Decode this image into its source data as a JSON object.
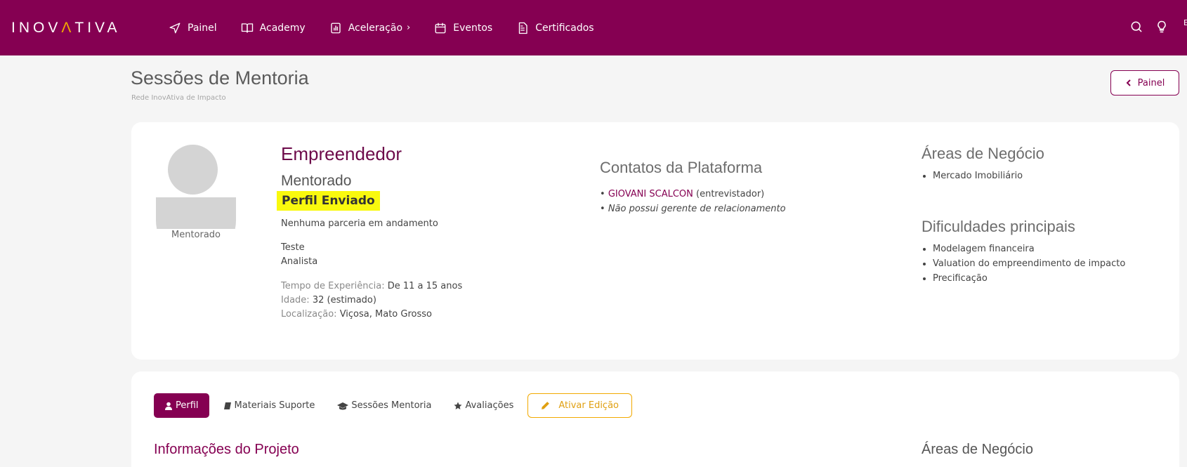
{
  "topbar": {
    "logo": {
      "pre": "INOV",
      "mark": "Λ",
      "post": "TIVA"
    },
    "nav": [
      {
        "label": "Painel",
        "icon": "navigation-arrow-icon"
      },
      {
        "label": "Academy",
        "icon": "book-icon"
      },
      {
        "label": "Aceleração",
        "icon": "chart-document-icon",
        "chevron": "›"
      },
      {
        "label": "Eventos",
        "icon": "calendar-icon"
      },
      {
        "label": "Certificados",
        "icon": "document-icon"
      }
    ],
    "icons": [
      "search-icon",
      "lightbulb-icon"
    ],
    "edge_letter": "E"
  },
  "header": {
    "title": "Sessões de Mentoria",
    "subtitle": "Rede InovAtiva de Impacto",
    "back_label": "Painel"
  },
  "profile": {
    "avatar_label": "Mentorado",
    "role_title": "Empreendedor",
    "role_sub": "Mentorado",
    "status": "Perfil Enviado",
    "partnership": "Nenhuma parceria em andamento",
    "name": "Teste",
    "position": "Analista",
    "experience_label": "Tempo de Experiência:",
    "experience_value": "De 11 a 15 anos",
    "age_label": "Idade:",
    "age_value": "32 (estimado)",
    "location_label": "Localização:",
    "location_value": "Viçosa, Mato Grosso"
  },
  "contacts": {
    "title": "Contatos da Plataforma",
    "interviewer_name": "GIOVANI SCALCON",
    "interviewer_role": "(entrevistador)",
    "no_manager": "Não possui gerente de relacionamento"
  },
  "business": {
    "areas_title": "Áreas de Negócio",
    "areas": [
      "Mercado Imobiliário"
    ],
    "difficulties_title": "Dificuldades principais",
    "difficulties": [
      "Modelagem financeira",
      "Valuation do empreendimento de impacto",
      "Precificação"
    ]
  },
  "tabs": {
    "items": [
      {
        "label": "Perfil",
        "icon": "user-icon"
      },
      {
        "label": "Materiais Suporte",
        "icon": "book-icon"
      },
      {
        "label": "Sessões Mentoria",
        "icon": "graduation-cap-icon"
      },
      {
        "label": "Avaliações",
        "icon": "star-icon"
      }
    ],
    "edit_label": "Ativar Edição"
  },
  "sections": {
    "project_info": "Informações do Projeto",
    "business_areas": "Áreas de Negócio"
  },
  "colors": {
    "brand": "#850052",
    "accent": "#f2a900",
    "highlight": "#f9f90e"
  }
}
